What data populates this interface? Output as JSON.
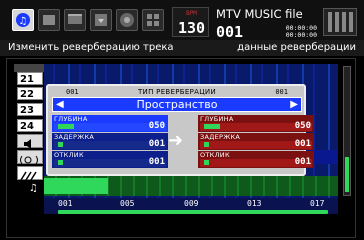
{
  "topbar": {
    "modes": [
      "wave-icon",
      "pattern-icon",
      "mixer-icon",
      "save-icon",
      "fx-icon",
      "grid-icon"
    ],
    "tempo_label": "BPM",
    "tempo_value": "130",
    "song_title": "MTV MUSIC file",
    "song_number": "001",
    "time_top": "00:00:00",
    "time_bottom": "00:00:00"
  },
  "hint": {
    "left": "Изменить реверберацию трека",
    "right": "данные реверберации"
  },
  "tracks": [
    "21",
    "22",
    "23",
    "24"
  ],
  "dialog": {
    "left_number": "001",
    "title": "ТИП РЕВЕРБЕРАЦИИ",
    "right_number": "001",
    "type_value": "Пространство",
    "left_params": [
      {
        "name": "ГЛУБИНА",
        "value": "050",
        "fill": 0.16
      },
      {
        "name": "ЗАДЕРЖКА",
        "value": "001",
        "fill": 0.05
      },
      {
        "name": "ОТКЛИК",
        "value": "001",
        "fill": 0.05
      }
    ],
    "right_params": [
      {
        "name": "ГЛУБИНА",
        "value": "050",
        "fill": 0.16
      },
      {
        "name": "ЗАДЕРЖКА",
        "value": "001",
        "fill": 0.05
      },
      {
        "name": "ОТКЛИК",
        "value": "001",
        "fill": 0.05
      }
    ]
  },
  "ruler": [
    "001",
    "005",
    "009",
    "013",
    "017"
  ],
  "colors": {
    "accent_blue": "#1a3bff",
    "accent_green": "#2fd85a",
    "accent_red": "#7a1010"
  }
}
